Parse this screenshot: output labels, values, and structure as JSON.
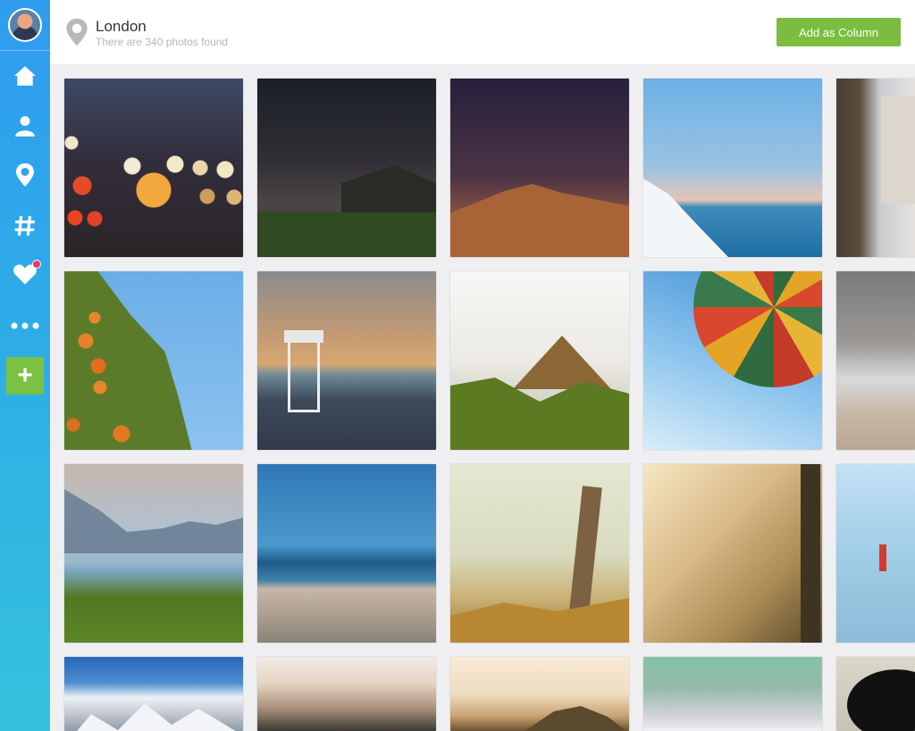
{
  "sidebar": {
    "avatar": "user-avatar",
    "items": [
      {
        "name": "home",
        "icon": "home-icon"
      },
      {
        "name": "profile",
        "icon": "user-icon"
      },
      {
        "name": "location",
        "icon": "location-pin-icon"
      },
      {
        "name": "hashtag",
        "icon": "hashtag-icon"
      },
      {
        "name": "likes",
        "icon": "heart-icon",
        "notification": true
      },
      {
        "name": "more",
        "icon": "more-dots-icon"
      }
    ],
    "add_label": "+",
    "gradient": [
      "#2f9cf0",
      "#35c2dc"
    ],
    "add_color": "#7bc242"
  },
  "header": {
    "title": "London",
    "subtitle": "There are 340 photos found",
    "add_column_label": "Add as Column",
    "button_color": "#7bbd3f"
  },
  "grid": {
    "rows": [
      [
        "bokeh-lights",
        "barn-at-night",
        "desert-dune",
        "sea-horizon",
        "brick-street"
      ],
      [
        "orange-tree",
        "lifeguard-tower",
        "boat-prow",
        "hot-air-balloon",
        "misty-beach"
      ],
      [
        "mountain-lake",
        "ocean-beach",
        "fence-post",
        "sunlit-field",
        "coastal-buoy"
      ],
      [
        "snowy-mountains",
        "hazy-valley",
        "rock-hill",
        "shore-horizon",
        "black-dog"
      ]
    ]
  }
}
